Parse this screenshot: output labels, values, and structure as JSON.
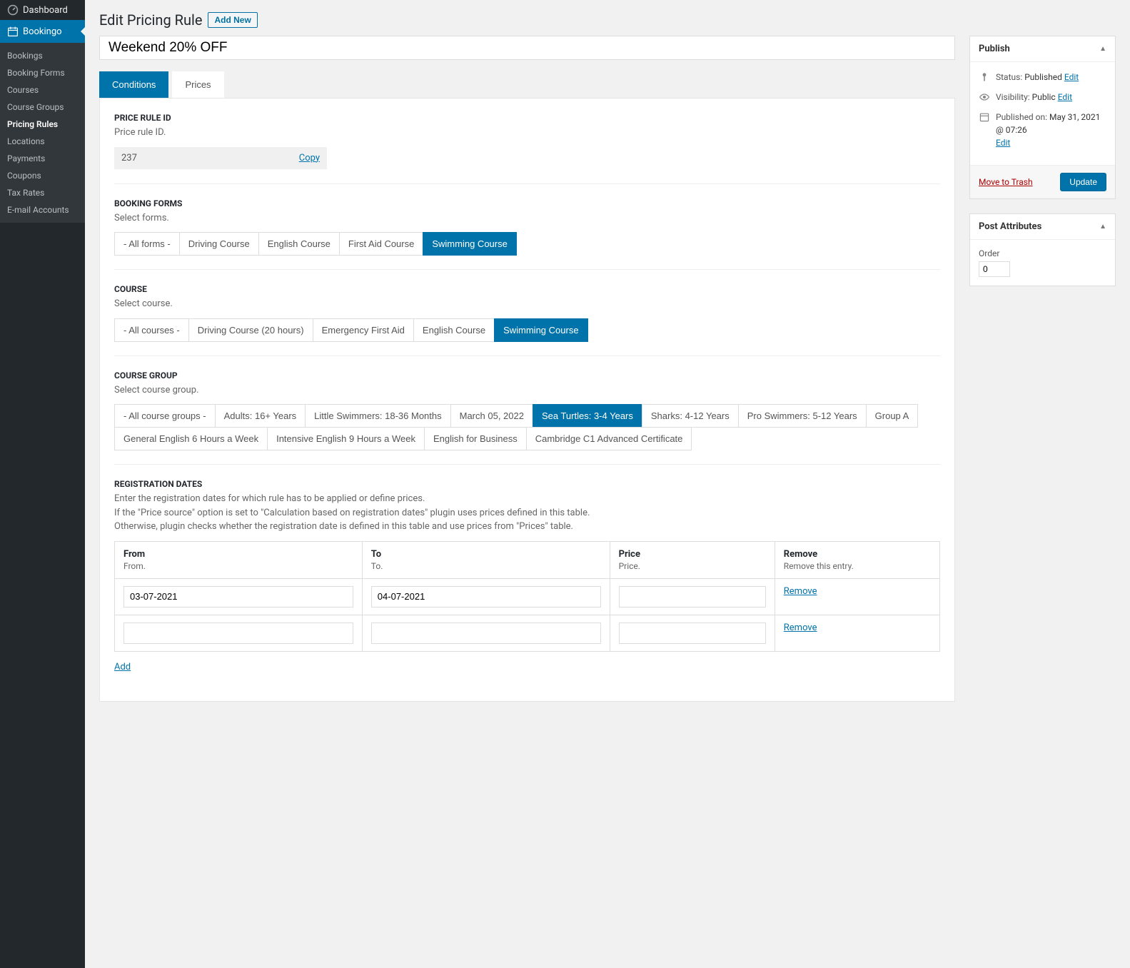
{
  "sidebar": {
    "dashboard": "Dashboard",
    "plugin": "Bookingo",
    "items": [
      {
        "label": "Bookings",
        "active": false
      },
      {
        "label": "Booking Forms",
        "active": false
      },
      {
        "label": "Courses",
        "active": false
      },
      {
        "label": "Course Groups",
        "active": false
      },
      {
        "label": "Pricing Rules",
        "active": true
      },
      {
        "label": "Locations",
        "active": false
      },
      {
        "label": "Payments",
        "active": false
      },
      {
        "label": "Coupons",
        "active": false
      },
      {
        "label": "Tax Rates",
        "active": false
      },
      {
        "label": "E-mail Accounts",
        "active": false
      }
    ]
  },
  "page": {
    "title": "Edit Pricing Rule",
    "add_new": "Add New",
    "name_value": "Weekend 20% OFF"
  },
  "tabs": {
    "conditions": "Conditions",
    "prices": "Prices"
  },
  "sections": {
    "rule_id": {
      "title": "PRICE RULE ID",
      "desc": "Price rule ID.",
      "value": "237",
      "copy": "Copy"
    },
    "booking_forms": {
      "title": "BOOKING FORMS",
      "desc": "Select forms.",
      "options": [
        {
          "label": "- All forms -",
          "sel": false
        },
        {
          "label": "Driving Course",
          "sel": false
        },
        {
          "label": "English Course",
          "sel": false
        },
        {
          "label": "First Aid Course",
          "sel": false
        },
        {
          "label": "Swimming Course",
          "sel": true
        }
      ]
    },
    "course": {
      "title": "COURSE",
      "desc": "Select course.",
      "options": [
        {
          "label": "- All courses -",
          "sel": false
        },
        {
          "label": "Driving Course (20 hours)",
          "sel": false
        },
        {
          "label": "Emergency First Aid",
          "sel": false
        },
        {
          "label": "English Course",
          "sel": false
        },
        {
          "label": "Swimming Course",
          "sel": true
        }
      ]
    },
    "course_group": {
      "title": "COURSE GROUP",
      "desc": "Select course group.",
      "options": [
        {
          "label": "- All course groups -",
          "sel": false
        },
        {
          "label": "Adults: 16+ Years",
          "sel": false
        },
        {
          "label": "Little Swimmers: 18-36 Months",
          "sel": false
        },
        {
          "label": "March 05, 2022",
          "sel": false
        },
        {
          "label": "Sea Turtles: 3-4 Years",
          "sel": true
        },
        {
          "label": "Sharks: 4-12 Years",
          "sel": false
        },
        {
          "label": "Pro Swimmers: 5-12 Years",
          "sel": false
        },
        {
          "label": "Group A",
          "sel": false
        },
        {
          "label": "General English 6 Hours a Week",
          "sel": false
        },
        {
          "label": "Intensive English 9 Hours a Week",
          "sel": false
        },
        {
          "label": "English for Business",
          "sel": false
        },
        {
          "label": "Cambridge C1 Advanced Certificate",
          "sel": false
        }
      ]
    },
    "reg": {
      "title": "REGISTRATION DATES",
      "desc1": "Enter the registration dates for which rule has to be applied or define prices.",
      "desc2": "If the \"Price source\" option is set to \"Calculation based on registration dates\" plugin uses prices defined in this table.",
      "desc3": "Otherwise, plugin checks whether the registration date is defined in this table and use prices from \"Prices\" table.",
      "headers": {
        "from": "From",
        "from_d": "From.",
        "to": "To",
        "to_d": "To.",
        "price": "Price",
        "price_d": "Price.",
        "remove": "Remove",
        "remove_d": "Remove this entry."
      },
      "rows": [
        {
          "from": "03-07-2021",
          "to": "04-07-2021",
          "price": ""
        },
        {
          "from": "",
          "to": "",
          "price": ""
        }
      ],
      "remove_link": "Remove",
      "add_link": "Add"
    }
  },
  "publish": {
    "title": "Publish",
    "status_l": "Status:",
    "status_v": "Published",
    "vis_l": "Visibility:",
    "vis_v": "Public",
    "pub_l": "Published on:",
    "pub_v": "May 31, 2021 @ 07:26",
    "edit": "Edit",
    "trash": "Move to Trash",
    "update": "Update"
  },
  "post_attrs": {
    "title": "Post Attributes",
    "order_l": "Order",
    "order_v": "0"
  }
}
